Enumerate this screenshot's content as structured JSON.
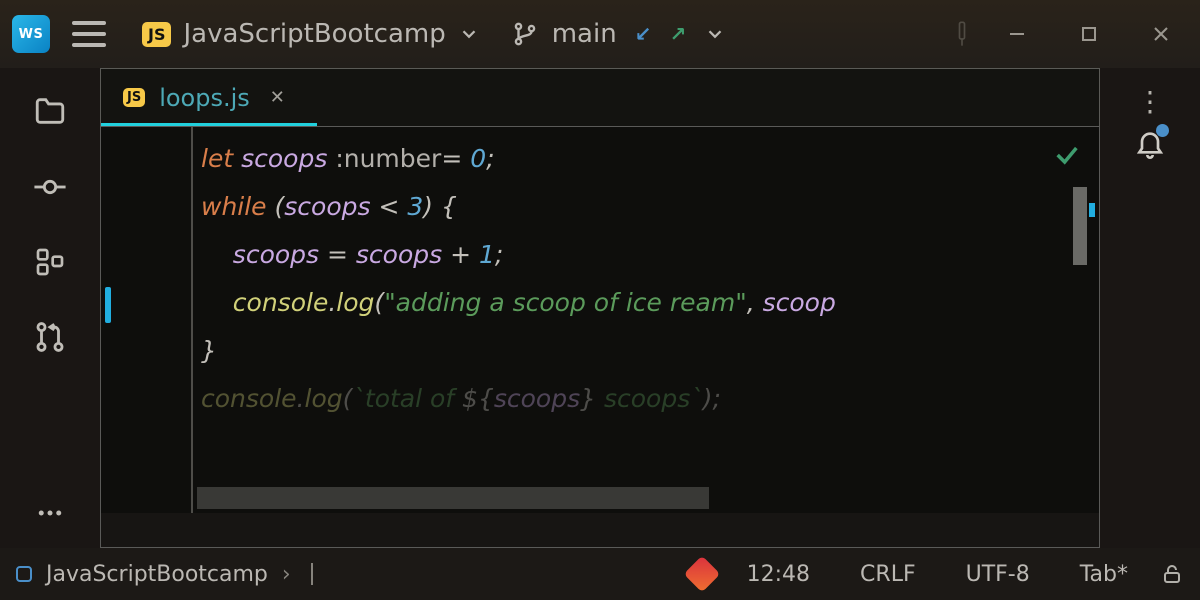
{
  "toolbar": {
    "app_logo_text": "WS",
    "project_name": "JavaScriptBootcamp",
    "branch_name": "main"
  },
  "tabs": [
    {
      "label": "loops.js",
      "icon": "js-file",
      "active": true
    }
  ],
  "code": {
    "l1": {
      "kw": "let",
      "id": "scoops",
      "annot": ":number",
      "eq": "= ",
      "val": "0",
      "end": ";"
    },
    "l2": {
      "kw": "while",
      "op": " (",
      "id": "scoops",
      "cmp": " < ",
      "val": "3",
      "close": ") {"
    },
    "l3": {
      "indent": "    ",
      "id": "scoops",
      "eq": " = ",
      "id2": "scoops",
      "plus": " + ",
      "val": "1",
      "end": ";"
    },
    "l4": {
      "indent": "    ",
      "obj": "console",
      "dot": ".",
      "fn": "log",
      "open": "(",
      "str": "\"adding a scoop of ice ream\"",
      "comma": ", ",
      "id": "scoop"
    },
    "l5": {
      "brace": "}"
    },
    "l6": {
      "obj": "console",
      "dot": ".",
      "fn": "log",
      "open": "(",
      "tick": "`",
      "txt1": "total of ",
      "interp": "${",
      "id": "scoops",
      "close": "}",
      "txt2": " scoops",
      "tick2": "`",
      ")": ");"
    }
  },
  "status": {
    "project": "JavaScriptBootcamp",
    "caret": "12:48",
    "line_sep": "CRLF",
    "encoding": "UTF-8",
    "indent": "Tab*"
  },
  "icons": {
    "chevron_down": "⌄"
  }
}
